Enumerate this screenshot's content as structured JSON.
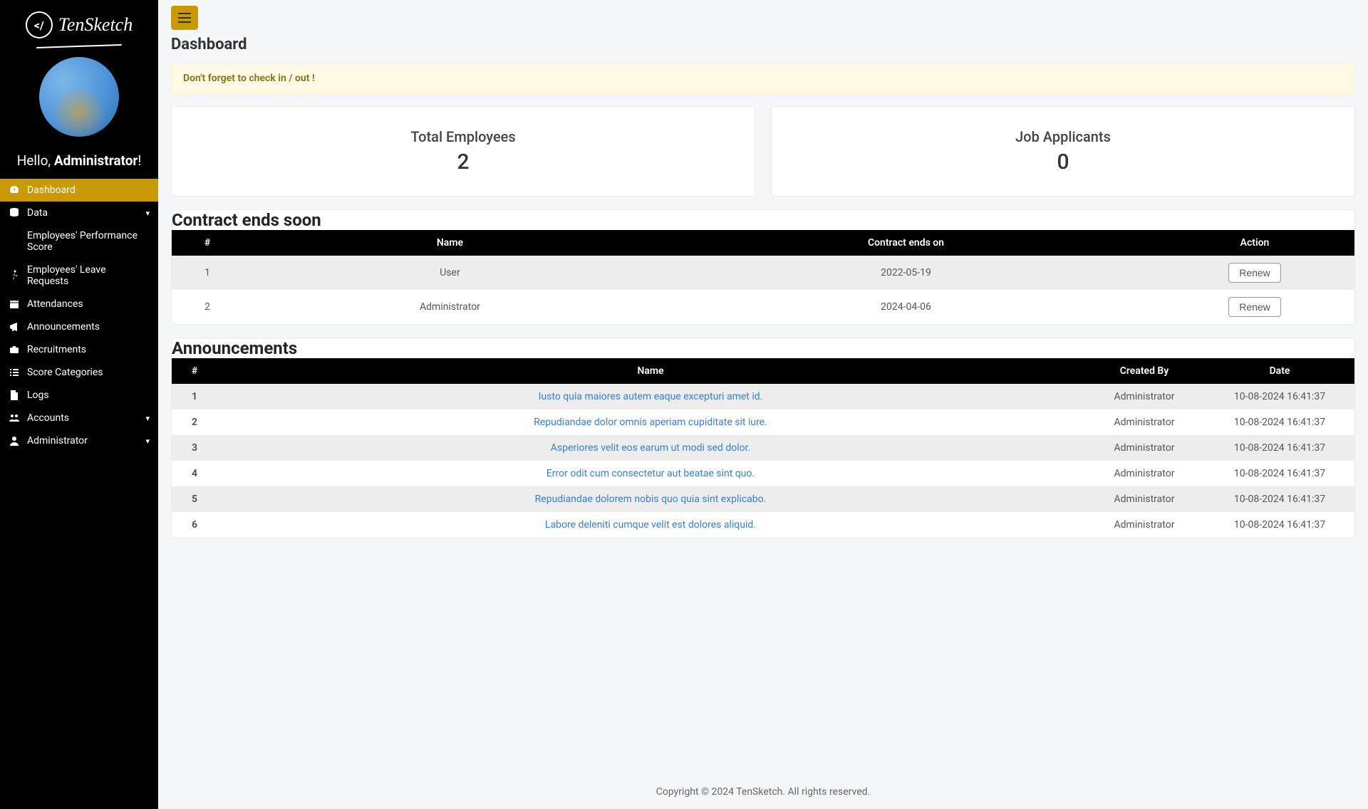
{
  "brand": "TenSketch",
  "greeting_prefix": "Hello, ",
  "greeting_name": "Administrator",
  "greeting_suffix": "!",
  "nav": [
    {
      "label": "Dashboard",
      "icon": "dashboard",
      "active": true,
      "caret": false
    },
    {
      "label": "Data",
      "icon": "database",
      "active": false,
      "caret": true
    },
    {
      "label": "Employees' Performance Score",
      "icon": "chart",
      "active": false,
      "caret": false
    },
    {
      "label": "Employees' Leave Requests",
      "icon": "walk",
      "active": false,
      "caret": false
    },
    {
      "label": "Attendances",
      "icon": "calendar",
      "active": false,
      "caret": false
    },
    {
      "label": "Announcements",
      "icon": "bullhorn",
      "active": false,
      "caret": false
    },
    {
      "label": "Recruitments",
      "icon": "briefcase",
      "active": false,
      "caret": false
    },
    {
      "label": "Score Categories",
      "icon": "list",
      "active": false,
      "caret": false
    },
    {
      "label": "Logs",
      "icon": "file",
      "active": false,
      "caret": false
    },
    {
      "label": "Accounts",
      "icon": "users",
      "active": false,
      "caret": true
    },
    {
      "label": "Administrator",
      "icon": "user",
      "active": false,
      "caret": true
    }
  ],
  "page_title": "Dashboard",
  "alert_text": "Don't forget to check in / out !",
  "cards": {
    "employees": {
      "title": "Total Employees",
      "value": "2"
    },
    "applicants": {
      "title": "Job Applicants",
      "value": "0"
    }
  },
  "contracts": {
    "title": "Contract ends soon",
    "headers": {
      "num": "#",
      "name": "Name",
      "ends": "Contract ends on",
      "action": "Action"
    },
    "renew_label": "Renew",
    "rows": [
      {
        "num": "1",
        "name": "User",
        "ends": "2022-05-19"
      },
      {
        "num": "2",
        "name": "Administrator",
        "ends": "2024-04-06"
      }
    ]
  },
  "announcements": {
    "title": "Announcements",
    "headers": {
      "num": "#",
      "name": "Name",
      "by": "Created By",
      "date": "Date"
    },
    "rows": [
      {
        "num": "1",
        "name": "Iusto quia maiores autem eaque excepturi amet id.",
        "by": "Administrator",
        "date": "10-08-2024 16:41:37"
      },
      {
        "num": "2",
        "name": "Repudiandae dolor omnis aperiam cupiditate sit iure.",
        "by": "Administrator",
        "date": "10-08-2024 16:41:37"
      },
      {
        "num": "3",
        "name": "Asperiores velit eos earum ut modi sed dolor.",
        "by": "Administrator",
        "date": "10-08-2024 16:41:37"
      },
      {
        "num": "4",
        "name": "Error odit cum consectetur aut beatae sint quo.",
        "by": "Administrator",
        "date": "10-08-2024 16:41:37"
      },
      {
        "num": "5",
        "name": "Repudiandae dolorem nobis quo quia sint explicabo.",
        "by": "Administrator",
        "date": "10-08-2024 16:41:37"
      },
      {
        "num": "6",
        "name": "Labore deleniti cumque velit est dolores aliquid.",
        "by": "Administrator",
        "date": "10-08-2024 16:41:37"
      }
    ]
  },
  "footer": "Copyright © 2024 TenSketch. All rights reserved."
}
